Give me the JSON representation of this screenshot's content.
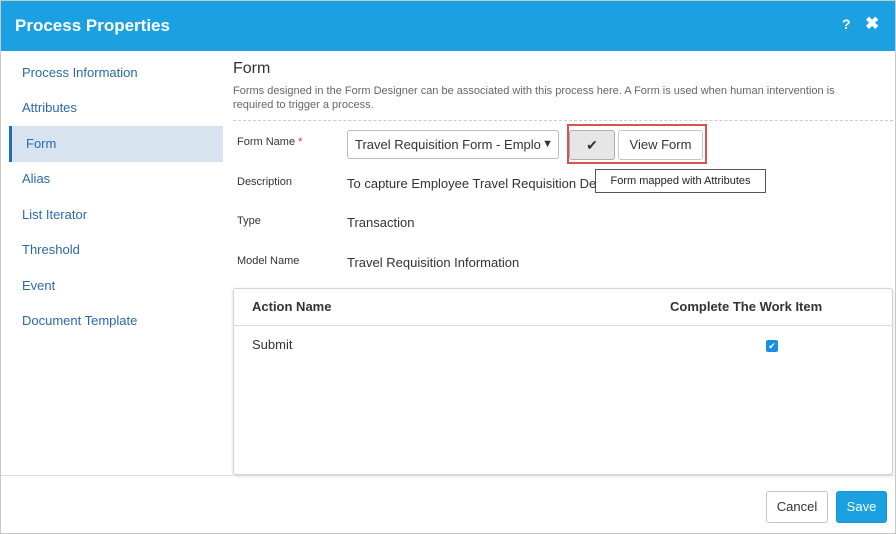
{
  "dialog": {
    "title": "Process Properties",
    "help_icon": "?",
    "close_icon": "✖",
    "accent_color": "#1ba1e2"
  },
  "sidebar": {
    "items": [
      {
        "label": "Process Information"
      },
      {
        "label": "Attributes"
      },
      {
        "label": "Form"
      },
      {
        "label": "Alias"
      },
      {
        "label": "List Iterator"
      },
      {
        "label": "Threshold"
      },
      {
        "label": "Event"
      },
      {
        "label": "Document Template"
      }
    ],
    "active": "Form"
  },
  "form_section": {
    "heading": "Form",
    "description": "Forms designed in the Form Designer can be associated with this process here. A Form is used when human intervention is required to trigger a process.",
    "form_name_label": "Form Name",
    "required_marker": "*",
    "form_name_value": "Travel Requisition Form - Emplo",
    "check_icon": "✔",
    "view_form_label": "View Form",
    "tooltip": "Form mapped with Attributes",
    "description_label": "Description",
    "description_value": "To capture Employee Travel Requisition De",
    "type_label": "Type",
    "type_value": "Transaction",
    "model_name_label": "Model Name",
    "model_name_value": "Travel Requisition Information"
  },
  "actions_table": {
    "columns": [
      "Action Name",
      "Complete The Work Item"
    ],
    "rows": [
      {
        "action": "Submit",
        "complete": true
      }
    ]
  },
  "footer": {
    "cancel_label": "Cancel",
    "save_label": "Save"
  }
}
